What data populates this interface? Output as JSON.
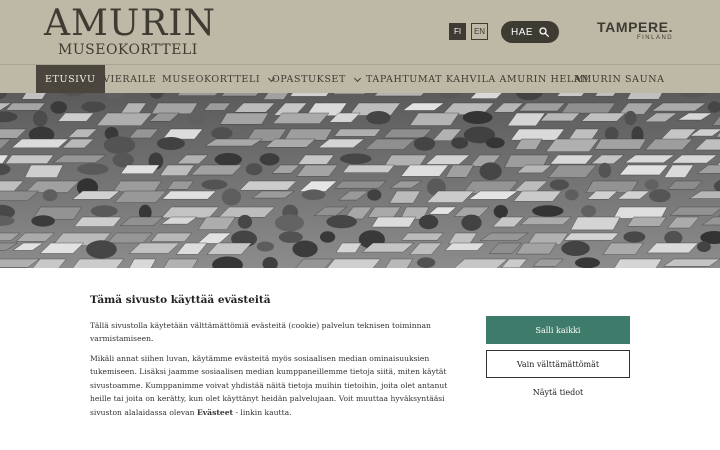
{
  "header": {
    "logo_main": "AMURIN",
    "logo_sub": "MUSEOKORTTELI",
    "lang_fi": "FI",
    "lang_en": "EN",
    "search_label": "HAE",
    "search_icon": "search-icon",
    "partner_main": "TAMPERE.",
    "partner_sub": "FINLAND"
  },
  "nav": {
    "items": [
      {
        "label": "ETUSIVU",
        "active": true
      },
      {
        "label": "VIERAILE"
      },
      {
        "label": "MUSEOKORTTELI",
        "dropdown": true
      },
      {
        "label": "OPASTUKSET",
        "dropdown": true
      },
      {
        "label": "TAPAHTUMAT"
      },
      {
        "label": "KAHVILA AMURIN HELMI"
      },
      {
        "label": "AMURIN SAUNA"
      }
    ]
  },
  "cookie": {
    "title": "Tämä sivusto käyttää evästeitä",
    "p1": "Tällä sivustolla käytetään välttämättömiä evästeitä (cookie) palvelun teknisen toiminnan varmistamiseen.",
    "p2_before": "Mikäli annat siihen luvan, käytämme evästeitä myös sosiaalisen median ominaisuuksien tukemiseen. Lisäksi jaamme sosiaalisen median kumppaneillemme tietoja siitä, miten käytät sivustoamme. Kumppanimme voivat yhdistää näitä tietoja muihin tietoihin, joita olet antanut heille tai joita on kerätty, kun olet käyttänyt heidän palvelujaan. Voit muuttaa hyväksyntääsi sivuston alalaidassa olevan",
    "p2_link": "Evästeet",
    "p2_after": "- linkin kautta.",
    "allow_all": "Salli kaikki",
    "necessary_only": "Vain välttämättömät",
    "details": "Näytä tiedot"
  },
  "colors": {
    "header_bg": "#bdb9a6",
    "dark": "#3e3b33",
    "accent_green": "#3f7b6a"
  }
}
